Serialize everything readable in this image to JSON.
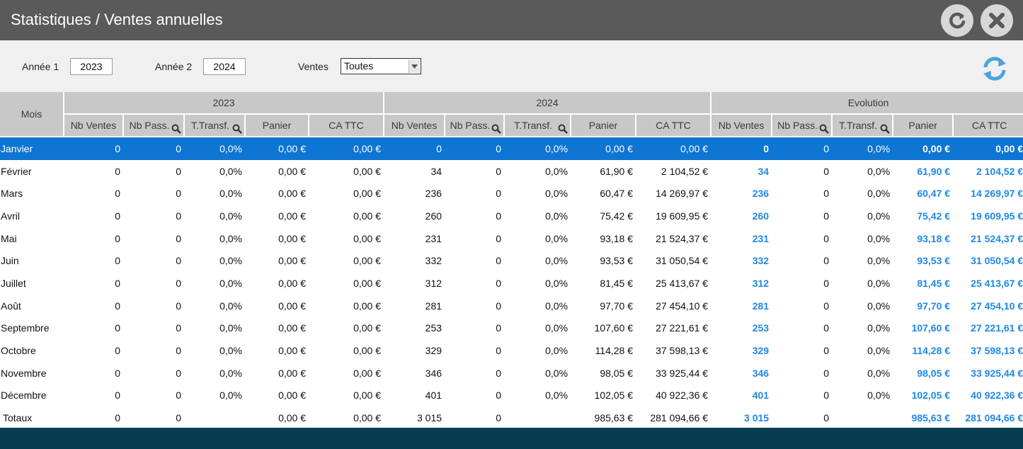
{
  "window": {
    "title": "Statistiques / Ventes annuelles"
  },
  "filters": {
    "annee1_label": "Année 1",
    "annee1_value": "2023",
    "annee2_label": "Année 2",
    "annee2_value": "2024",
    "ventes_label": "Ventes",
    "ventes_value": "Toutes"
  },
  "table": {
    "mois_header": "Mois",
    "group_headers": [
      "2023",
      "2024",
      "Evolution"
    ],
    "sub_headers": [
      "Nb Ventes",
      "Nb Pass.",
      "T.Transf.",
      "Panier",
      "CA TTC"
    ],
    "rows": [
      {
        "mois": "Janvier",
        "a": [
          "0",
          "0",
          "0,0%",
          "0,00 €",
          "0,00 €"
        ],
        "b": [
          "0",
          "0",
          "0,0%",
          "0,00 €",
          "0,00 €"
        ],
        "e": [
          "0",
          "0",
          "0,0%",
          "0,00 €",
          "0,00 €"
        ]
      },
      {
        "mois": "Février",
        "a": [
          "0",
          "0",
          "0,0%",
          "0,00 €",
          "0,00 €"
        ],
        "b": [
          "34",
          "0",
          "0,0%",
          "61,90 €",
          "2 104,52 €"
        ],
        "e": [
          "34",
          "0",
          "0,0%",
          "61,90 €",
          "2 104,52 €"
        ]
      },
      {
        "mois": "Mars",
        "a": [
          "0",
          "0",
          "0,0%",
          "0,00 €",
          "0,00 €"
        ],
        "b": [
          "236",
          "0",
          "0,0%",
          "60,47 €",
          "14 269,97 €"
        ],
        "e": [
          "236",
          "0",
          "0,0%",
          "60,47 €",
          "14 269,97 €"
        ]
      },
      {
        "mois": "Avril",
        "a": [
          "0",
          "0",
          "0,0%",
          "0,00 €",
          "0,00 €"
        ],
        "b": [
          "260",
          "0",
          "0,0%",
          "75,42 €",
          "19 609,95 €"
        ],
        "e": [
          "260",
          "0",
          "0,0%",
          "75,42 €",
          "19 609,95 €"
        ]
      },
      {
        "mois": "Mai",
        "a": [
          "0",
          "0",
          "0,0%",
          "0,00 €",
          "0,00 €"
        ],
        "b": [
          "231",
          "0",
          "0,0%",
          "93,18 €",
          "21 524,37 €"
        ],
        "e": [
          "231",
          "0",
          "0,0%",
          "93,18 €",
          "21 524,37 €"
        ]
      },
      {
        "mois": "Juin",
        "a": [
          "0",
          "0",
          "0,0%",
          "0,00 €",
          "0,00 €"
        ],
        "b": [
          "332",
          "0",
          "0,0%",
          "93,53 €",
          "31 050,54 €"
        ],
        "e": [
          "332",
          "0",
          "0,0%",
          "93,53 €",
          "31 050,54 €"
        ]
      },
      {
        "mois": "Juillet",
        "a": [
          "0",
          "0",
          "0,0%",
          "0,00 €",
          "0,00 €"
        ],
        "b": [
          "312",
          "0",
          "0,0%",
          "81,45 €",
          "25 413,67 €"
        ],
        "e": [
          "312",
          "0",
          "0,0%",
          "81,45 €",
          "25 413,67 €"
        ]
      },
      {
        "mois": "Août",
        "a": [
          "0",
          "0",
          "0,0%",
          "0,00 €",
          "0,00 €"
        ],
        "b": [
          "281",
          "0",
          "0,0%",
          "97,70 €",
          "27 454,10 €"
        ],
        "e": [
          "281",
          "0",
          "0,0%",
          "97,70 €",
          "27 454,10 €"
        ]
      },
      {
        "mois": "Septembre",
        "a": [
          "0",
          "0",
          "0,0%",
          "0,00 €",
          "0,00 €"
        ],
        "b": [
          "253",
          "0",
          "0,0%",
          "107,60 €",
          "27 221,61 €"
        ],
        "e": [
          "253",
          "0",
          "0,0%",
          "107,60 €",
          "27 221,61 €"
        ]
      },
      {
        "mois": "Octobre",
        "a": [
          "0",
          "0",
          "0,0%",
          "0,00 €",
          "0,00 €"
        ],
        "b": [
          "329",
          "0",
          "0,0%",
          "114,28 €",
          "37 598,13 €"
        ],
        "e": [
          "329",
          "0",
          "0,0%",
          "114,28 €",
          "37 598,13 €"
        ]
      },
      {
        "mois": "Novembre",
        "a": [
          "0",
          "0",
          "0,0%",
          "0,00 €",
          "0,00 €"
        ],
        "b": [
          "346",
          "0",
          "0,0%",
          "98,05 €",
          "33 925,44 €"
        ],
        "e": [
          "346",
          "0",
          "0,0%",
          "98,05 €",
          "33 925,44 €"
        ]
      },
      {
        "mois": "Décembre",
        "a": [
          "0",
          "0",
          "0,0%",
          "0,00 €",
          "0,00 €"
        ],
        "b": [
          "401",
          "0",
          "0,0%",
          "102,05 €",
          "40 922,36 €"
        ],
        "e": [
          "401",
          "0",
          "0,0%",
          "102,05 €",
          "40 922,36 €"
        ]
      }
    ],
    "totals": {
      "mois": "Totaux",
      "a": [
        "0",
        "0",
        "",
        "0,00 €",
        "0,00 €"
      ],
      "b": [
        "3 015",
        "0",
        "",
        "985,63 €",
        "281 094,66 €"
      ],
      "e": [
        "3 015",
        "0",
        "",
        "985,63 €",
        "281 094,66 €"
      ]
    }
  },
  "colors": {
    "titlebar": "#5a5a5a",
    "header_bg": "#c8c8c8",
    "selected_row": "#0f75d3",
    "evolution_text": "#1e88e5",
    "footer": "#053c4e",
    "refresh_icon": "#4aa3df"
  },
  "icons": {
    "reload": "reload-icon",
    "close": "close-icon",
    "refresh": "refresh-icon",
    "search": "magnifier-icon",
    "dropdown": "chevron-down-icon"
  }
}
